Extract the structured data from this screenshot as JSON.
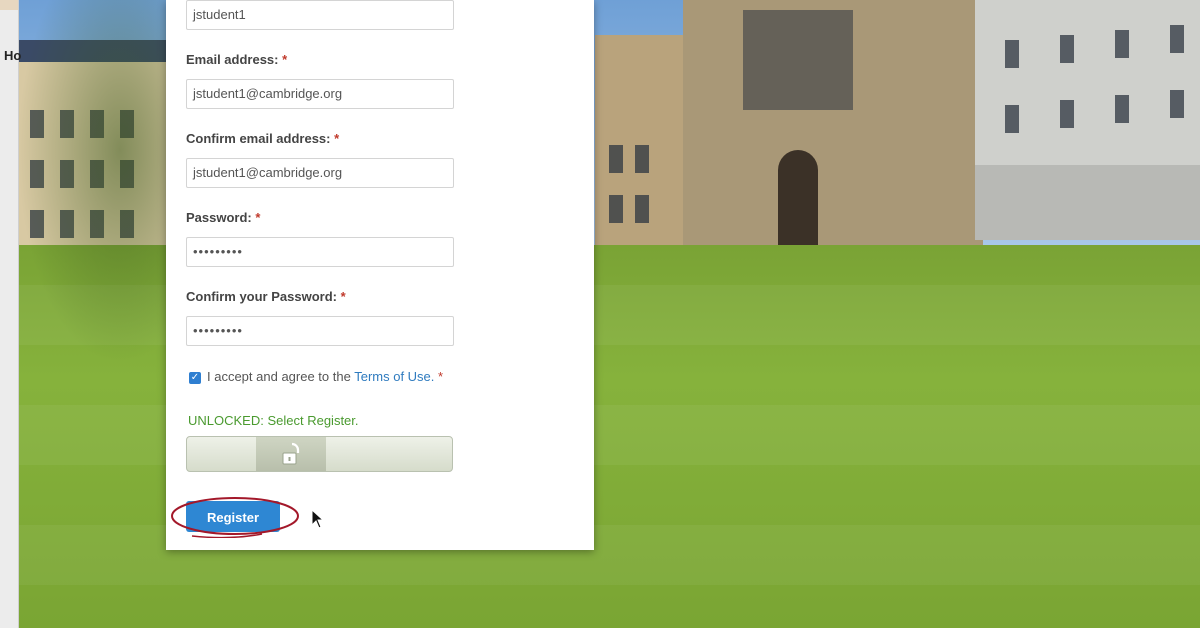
{
  "left_tab": {
    "label": "Ho"
  },
  "form": {
    "username": {
      "value": "jstudent1"
    },
    "email": {
      "label": "Email address:",
      "required": "*",
      "value": "jstudent1@cambridge.org"
    },
    "confirm_email": {
      "label": "Confirm email address:",
      "required": "*",
      "value": "jstudent1@cambridge.org"
    },
    "password": {
      "label": "Password:",
      "required": "*",
      "value": "•••••••••"
    },
    "confirm_password": {
      "label": "Confirm your Password:",
      "required": "*",
      "value": "•••••••••"
    },
    "terms": {
      "checked": true,
      "prefix": "I accept and agree to the",
      "link": "Terms of Use.",
      "required": "*"
    },
    "captcha": {
      "status": "UNLOCKED: Select Register.",
      "icon": "unlock-icon"
    },
    "register_label": "Register"
  },
  "colors": {
    "accent": "#2e87d3",
    "required": "#c0392b",
    "success": "#4a9a2f",
    "link": "#2f7bbf"
  }
}
